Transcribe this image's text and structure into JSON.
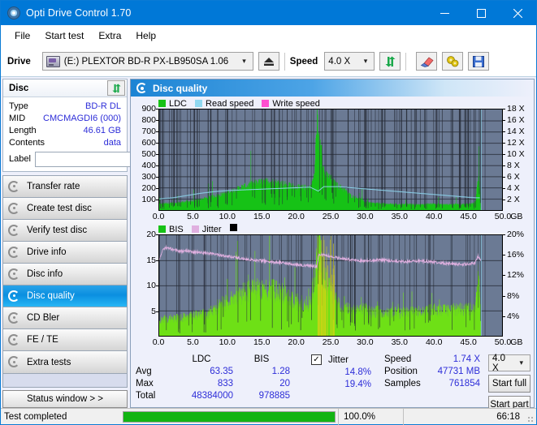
{
  "window": {
    "title": "Opti Drive Control 1.70",
    "icon": "disc-icon",
    "minimize": "minimize-icon",
    "maximize": "maximize-icon",
    "close": "close-icon"
  },
  "menu": {
    "items": [
      {
        "label": "File"
      },
      {
        "label": "Start test"
      },
      {
        "label": "Extra"
      },
      {
        "label": "Help"
      }
    ]
  },
  "toolbar": {
    "drive_label": "Drive",
    "drive_value": "(E:)  PLEXTOR BD-R  PX-LB950SA 1.06",
    "eject_icon": "eject-icon",
    "speed_label": "Speed",
    "speed_value": "4.0 X",
    "refresh_icon": "refresh-icon",
    "erase_icon": "eraser-icon",
    "settings_icon": "gears-icon",
    "save_icon": "floppy-save-icon"
  },
  "disc_panel": {
    "title": "Disc",
    "refresh_icon": "refresh-icon",
    "rows": [
      {
        "key": "Type",
        "value": "BD-R DL"
      },
      {
        "key": "MID",
        "value": "CMCMAGDI6 (000)"
      },
      {
        "key": "Length",
        "value": "46.61 GB"
      },
      {
        "key": "Contents",
        "value": "data"
      }
    ],
    "label_key": "Label",
    "label_value": "",
    "label_placeholder": "",
    "label_button_icon": "disc-icon"
  },
  "nav": {
    "items": [
      {
        "label": "Transfer rate",
        "icon": "disc-test-icon",
        "active": false
      },
      {
        "label": "Create test disc",
        "icon": "disc-burn-icon",
        "active": false
      },
      {
        "label": "Verify test disc",
        "icon": "disc-verify-icon",
        "active": false
      },
      {
        "label": "Drive info",
        "icon": "drive-info-icon",
        "active": false
      },
      {
        "label": "Disc info",
        "icon": "disc-info-icon",
        "active": false
      },
      {
        "label": "Disc quality",
        "icon": "disc-quality-icon",
        "active": true
      },
      {
        "label": "CD Bler",
        "icon": "disc-bler-icon",
        "active": false
      },
      {
        "label": "FE / TE",
        "icon": "disc-fete-icon",
        "active": false
      },
      {
        "label": "Extra tests",
        "icon": "disc-extra-icon",
        "active": false
      }
    ],
    "status_window_button": "Status window > >"
  },
  "main": {
    "header": "Disc quality",
    "header_icon": "disc-quality-icon"
  },
  "stats": {
    "columns": [
      "LDC",
      "BIS"
    ],
    "rows": [
      {
        "key": "Avg",
        "ldc": "63.35",
        "bis": "1.28"
      },
      {
        "key": "Max",
        "ldc": "833",
        "bis": "20"
      },
      {
        "key": "Total",
        "ldc": "48384000",
        "bis": "978885"
      }
    ],
    "jitter_label": "Jitter",
    "jitter_checked": true,
    "jitter_checkmark": "✓",
    "jitter_avg": "14.8%",
    "jitter_max": "19.4%",
    "speed_key": "Speed",
    "speed_value": "1.74 X",
    "position_key": "Position",
    "position_value": "47731 MB",
    "samples_key": "Samples",
    "samples_value": "761854",
    "speed_select": "4.0 X",
    "start_full": "Start full",
    "start_part": "Start part"
  },
  "statusbar": {
    "text": "Test completed",
    "progress_percent": 100.0,
    "progress_label": "100.0%",
    "elapsed": "66:18"
  },
  "colors": {
    "accent": "#0078d7",
    "ldc_green": "#16c216",
    "bis_green": "#16c216",
    "read_speed": "#8fd8f0",
    "write_speed": "#ff4fd0",
    "jitter_pink": "#e0b0e0",
    "plot_bg": "#6b7a94",
    "value_blue": "#2d2dd8",
    "progress_green": "#12b412"
  },
  "chart_data": [
    {
      "type": "area",
      "id": "ldc-chart",
      "title": "",
      "xlabel": "GB",
      "ylabel": "",
      "xlim": [
        0,
        50
      ],
      "ylim": [
        0,
        900
      ],
      "y2lim": [
        0,
        18
      ],
      "y2label": "X",
      "grid": true,
      "legend_position": "top-left",
      "xticks": [
        "0.0",
        "5.0",
        "10.0",
        "15.0",
        "20.0",
        "25.0",
        "30.0",
        "35.0",
        "40.0",
        "45.0",
        "50.0"
      ],
      "yticks": [
        100,
        200,
        300,
        400,
        500,
        600,
        700,
        800,
        900
      ],
      "y2ticks": [
        "2 X",
        "4 X",
        "6 X",
        "8 X",
        "10 X",
        "12 X",
        "14 X",
        "16 X",
        "18 X"
      ],
      "legend": [
        {
          "name": "LDC",
          "color": "#16c216"
        },
        {
          "name": "Read speed",
          "color": "#8fd8f0"
        },
        {
          "name": "Write speed",
          "color": "#ff4fd0"
        }
      ],
      "series": [
        {
          "name": "LDC",
          "type": "area",
          "color": "#16c216",
          "x": [
            0,
            1,
            2,
            3,
            4,
            5,
            6,
            7,
            8,
            9,
            10,
            11,
            12,
            13,
            14,
            15,
            16,
            17,
            18,
            19,
            20,
            21,
            22,
            22.6,
            23,
            23.2,
            23.4,
            23.6,
            23.8,
            24,
            24.3,
            24.6,
            25,
            25.4,
            26,
            26.6,
            27,
            28,
            29,
            30,
            31,
            32,
            33,
            34,
            35,
            36,
            37,
            38,
            39,
            40,
            41,
            42,
            43,
            44,
            45,
            46,
            46.6,
            47
          ],
          "values": [
            55,
            60,
            62,
            68,
            75,
            80,
            92,
            105,
            120,
            135,
            155,
            175,
            200,
            215,
            235,
            245,
            250,
            240,
            230,
            215,
            200,
            195,
            200,
            300,
            835,
            610,
            560,
            620,
            430,
            330,
            300,
            290,
            275,
            240,
            210,
            190,
            175,
            120,
            105,
            70,
            60,
            58,
            55,
            52,
            50,
            52,
            50,
            48,
            52,
            55,
            50,
            48,
            52,
            50,
            55,
            60,
            300,
            0
          ]
        },
        {
          "name": "Read speed",
          "type": "line",
          "color": "#8fd8f0",
          "axis": "y2",
          "x": [
            0,
            2,
            4,
            6,
            8,
            10,
            12,
            14,
            16,
            18,
            20,
            22,
            23.2,
            24,
            26,
            28,
            30,
            32,
            34,
            36,
            38,
            40,
            42,
            44,
            46,
            46.8,
            46.9
          ],
          "values": [
            2.0,
            2.2,
            2.6,
            3.0,
            3.3,
            3.5,
            3.6,
            3.7,
            3.8,
            3.9,
            4.0,
            4.1,
            3.4,
            4.2,
            4.2,
            4.0,
            3.8,
            3.6,
            3.4,
            3.2,
            3.0,
            2.8,
            2.6,
            2.4,
            2.2,
            2.2,
            18.0
          ]
        }
      ]
    },
    {
      "type": "area",
      "id": "bis-jitter-chart",
      "title": "",
      "xlabel": "GB",
      "ylabel": "",
      "xlim": [
        0,
        50
      ],
      "ylim": [
        0,
        20
      ],
      "y2lim": [
        0,
        20
      ],
      "y2label": "%",
      "grid": true,
      "legend_position": "top-left",
      "xticks": [
        "0.0",
        "5.0",
        "10.0",
        "15.0",
        "20.0",
        "25.0",
        "30.0",
        "35.0",
        "40.0",
        "45.0",
        "50.0"
      ],
      "yticks": [
        5,
        10,
        15,
        20
      ],
      "y2ticks": [
        "4%",
        "8%",
        "12%",
        "16%",
        "20%"
      ],
      "legend": [
        {
          "name": "BIS",
          "color": "#16c216"
        },
        {
          "name": "Jitter",
          "color": "#e0b0e0"
        }
      ],
      "series": [
        {
          "name": "BIS",
          "type": "area",
          "color": "#6ee016",
          "x": [
            0,
            1,
            2,
            3,
            4,
            5,
            6,
            7,
            8,
            9,
            10,
            11,
            12,
            13,
            14,
            15,
            16,
            17,
            18,
            19,
            20,
            21,
            22,
            23,
            23.3,
            23.6,
            24,
            24.5,
            25,
            25.5,
            26,
            27,
            28,
            29,
            30,
            31,
            32,
            33,
            34,
            35,
            36,
            37,
            38,
            39,
            40,
            41,
            42,
            43,
            44,
            45,
            46,
            46.6,
            47
          ],
          "values": [
            3.0,
            3.2,
            3.3,
            3.4,
            3.6,
            3.8,
            4.0,
            4.2,
            5.0,
            6.0,
            6.5,
            7.5,
            8.0,
            8.5,
            8.8,
            9.0,
            8.8,
            8.6,
            8.0,
            7.0,
            6.5,
            6.0,
            6.0,
            14.0,
            20.0,
            13.0,
            12.0,
            10.0,
            9.0,
            7.0,
            6.0,
            5.5,
            5.0,
            4.8,
            5.0,
            4.5,
            4.6,
            4.4,
            4.5,
            4.3,
            4.4,
            4.5,
            4.6,
            4.8,
            5.0,
            4.8,
            4.9,
            5.0,
            5.0,
            5.2,
            5.5,
            12.2,
            0
          ]
        },
        {
          "name": "Jitter",
          "type": "line",
          "color": "#e0b0e0",
          "axis": "y2",
          "x": [
            0,
            0.5,
            1,
            2,
            3,
            4,
            5,
            6,
            7,
            8,
            9,
            10,
            11,
            12,
            13,
            14,
            15,
            16,
            17,
            18,
            19,
            20,
            21,
            22,
            23,
            23.3,
            24,
            25,
            26,
            27,
            28,
            29,
            30,
            31,
            32,
            33,
            34,
            35,
            36,
            37,
            38,
            39,
            40,
            41,
            42,
            43,
            44,
            45,
            46,
            46.5,
            46.9
          ],
          "values": [
            14.9,
            17.0,
            17.5,
            17.2,
            16.8,
            16.9,
            16.6,
            16.6,
            16.4,
            16.2,
            16.0,
            15.8,
            15.6,
            15.4,
            15.2,
            15.0,
            14.9,
            14.8,
            14.6,
            14.5,
            14.3,
            14.2,
            14.0,
            13.9,
            13.8,
            16.2,
            16.1,
            15.8,
            15.5,
            15.3,
            15.1,
            15.0,
            14.9,
            15.0,
            15.1,
            15.0,
            14.9,
            14.8,
            14.7,
            14.8,
            14.9,
            14.8,
            14.7,
            14.5,
            14.4,
            14.3,
            14.2,
            14.3,
            14.4,
            15.8,
            14.8
          ]
        }
      ]
    }
  ]
}
